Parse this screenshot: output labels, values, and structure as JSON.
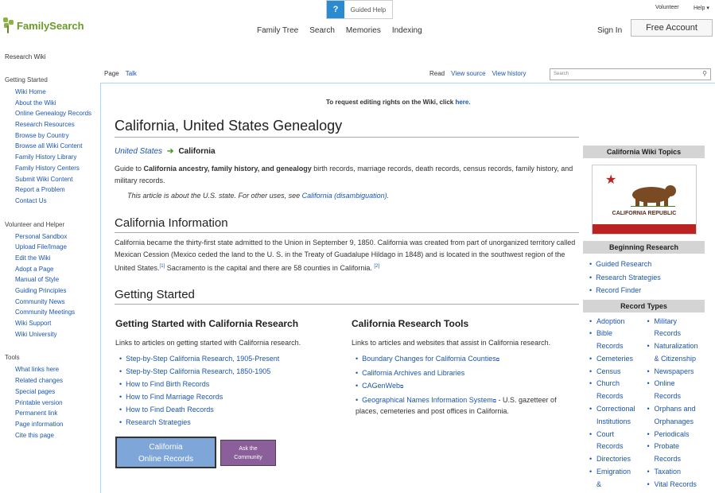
{
  "header": {
    "guided_help": "Guided Help",
    "guided_q": "?",
    "volunteer": "Volunteer",
    "help": "Help ▾",
    "logo": "FamilySearch",
    "nav": [
      "Family Tree",
      "Search",
      "Memories",
      "Indexing"
    ],
    "sign_in": "Sign In",
    "free_account": "Free Account"
  },
  "research_wiki": "Research Wiki",
  "sidebar": {
    "sections": [
      {
        "title": "Getting Started",
        "items": [
          "Wiki Home",
          "About the Wiki",
          "Online Genealogy Records",
          "Research Resources",
          "Browse by Country",
          "Browse all Wiki Content",
          "Family History Library",
          "Family History Centers",
          "Submit Wiki Content",
          "Report a Problem",
          "Contact Us"
        ]
      },
      {
        "title": "Volunteer and Helper",
        "items": [
          "Personal Sandbox",
          "Upload File/Image",
          "Edit the Wiki",
          "Adopt a Page",
          "Manual of Style",
          "Guiding Principles",
          "Community News",
          "Community Meetings",
          "Wiki Support",
          "Wiki University"
        ]
      },
      {
        "title": "Tools",
        "items": [
          "What links here",
          "Related changes",
          "Special pages",
          "Printable version",
          "Permanent link",
          "Page information",
          "Cite this page"
        ]
      }
    ]
  },
  "tabs": {
    "page": "Page",
    "talk": "Talk",
    "read": "Read",
    "view_source": "View source",
    "view_history": "View history",
    "search_placeholder": "Search"
  },
  "notice": {
    "text": "To request editing rights on the Wiki, click ",
    "link": "here."
  },
  "title": "California, United States Genealogy",
  "breadcrumb": {
    "parent": "United States",
    "current": "California"
  },
  "intro": {
    "pre": "Guide to ",
    "bold": "California ancestry, family history, and genealogy",
    "post": " birth records, marriage records, death records, census records, family history, and military records."
  },
  "hatnote": {
    "text": "This article is about the U.S. state. For other uses, see ",
    "link": "California (disambiguation)."
  },
  "info": {
    "heading": "California Information",
    "p1": "California became the thirty-first state admitted to the Union in September 9, 1850. California was created from part of unorganized territory called Mexican Cession (Mexico ceded the land to the U. S. in the Treaty of Guadalupe Hildago in 1848) and is located in the southwest region of the United States.",
    "ref1": "[1]",
    "p2": " Sacramento is the capital and there are 58 counties in California. ",
    "ref2": "[2]"
  },
  "getting_started": {
    "heading": "Getting Started",
    "col1": {
      "title": "Getting Started with California Research",
      "desc": "Links to articles on getting started with California research.",
      "items": [
        "Step-by-Step California Research, 1905-Present",
        "Step-by-Step California Research, 1850-1905",
        "How to Find Birth Records",
        "How to Find Marriage Records",
        "How to Find Death Records",
        "Research Strategies"
      ]
    },
    "col2": {
      "title": "California Research Tools",
      "desc": "Links to articles and websites that assist in California research.",
      "items": [
        "Boundary Changes for California Counties",
        "California Archives and Libraries",
        "CAGenWeb",
        "Geographical Names Information System"
      ],
      "gazetteer": " - U.S. gazetteer of places, cemeteries and post offices in California."
    },
    "btn_records": {
      "line1": "California",
      "line2": "Online Records"
    },
    "btn_ask": {
      "line1": "Ask the",
      "line2": "Community"
    }
  },
  "infobox": {
    "topics": "California Wiki Topics",
    "flag_text": "CALIFORNIA REPUBLIC",
    "beginning": "Beginning Research",
    "beginning_items": [
      "Guided Research",
      "Research Strategies",
      "Record Finder"
    ],
    "record_types": "Record Types",
    "col1": [
      [
        "Adoption"
      ],
      [
        "Bible",
        "Records"
      ],
      [
        "Cemeteries"
      ],
      [
        "Census"
      ],
      [
        "Church",
        "Records"
      ],
      [
        "Correctional",
        "Institutions"
      ],
      [
        "Court",
        "Records"
      ],
      [
        "Directories"
      ],
      [
        "Emigration",
        "&"
      ]
    ],
    "col2": [
      [
        "Military",
        "Records"
      ],
      [
        "Naturalization",
        "& Citizenship"
      ],
      [
        "Newspapers"
      ],
      [
        "Online",
        "Records"
      ],
      [
        "Orphans and",
        "Orphanages"
      ],
      [
        "Periodicals"
      ],
      [
        "Probate",
        "Records"
      ],
      [
        "Taxation"
      ],
      [
        "Vital Records"
      ]
    ]
  },
  "colors": {
    "link": "#1a55b3",
    "brand_green": "#6a9a2a",
    "guided_blue": "#2a8bd0",
    "ask_purple": "#8a5f9a",
    "records_blue": "#7ea6d8"
  }
}
